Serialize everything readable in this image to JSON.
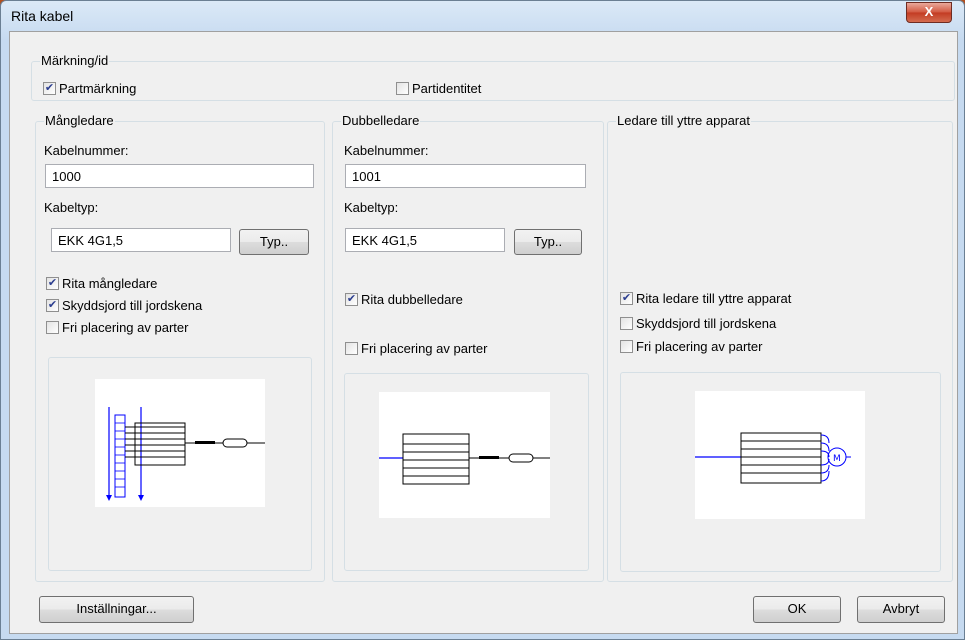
{
  "window": {
    "title": "Rita kabel",
    "close_glyph": "X"
  },
  "marking": {
    "legend": "Märkning/id",
    "part_marking": {
      "label": "Partmärkning",
      "checked": true
    },
    "part_identity": {
      "label": "Partidentitet",
      "checked": false
    }
  },
  "multi": {
    "legend": "Mångledare",
    "cable_number_label": "Kabelnummer:",
    "cable_number": "1000",
    "cable_type_label": "Kabeltyp:",
    "cable_type": "EKK 4G1,5",
    "type_button": "Typ..",
    "draw": {
      "label": "Rita mångledare",
      "checked": true
    },
    "earth": {
      "label": "Skyddsjord till jordskena",
      "checked": true
    },
    "free": {
      "label": "Fri placering av parter",
      "checked": false
    }
  },
  "double": {
    "legend": "Dubbelledare",
    "cable_number_label": "Kabelnummer:",
    "cable_number": "1001",
    "cable_type_label": "Kabeltyp:",
    "cable_type": "EKK 4G1,5",
    "type_button": "Typ..",
    "draw": {
      "label": "Rita dubbelledare",
      "checked": true
    },
    "free": {
      "label": "Fri placering av parter",
      "checked": false
    }
  },
  "external": {
    "legend": "Ledare till yttre apparat",
    "draw": {
      "label": "Rita ledare till yttre apparat",
      "checked": true
    },
    "earth": {
      "label": "Skyddsjord till jordskena",
      "checked": false
    },
    "free": {
      "label": "Fri placering av parter",
      "checked": false
    }
  },
  "footer": {
    "settings_button": "Inställningar...",
    "ok_button": "OK",
    "cancel_button": "Avbryt"
  }
}
